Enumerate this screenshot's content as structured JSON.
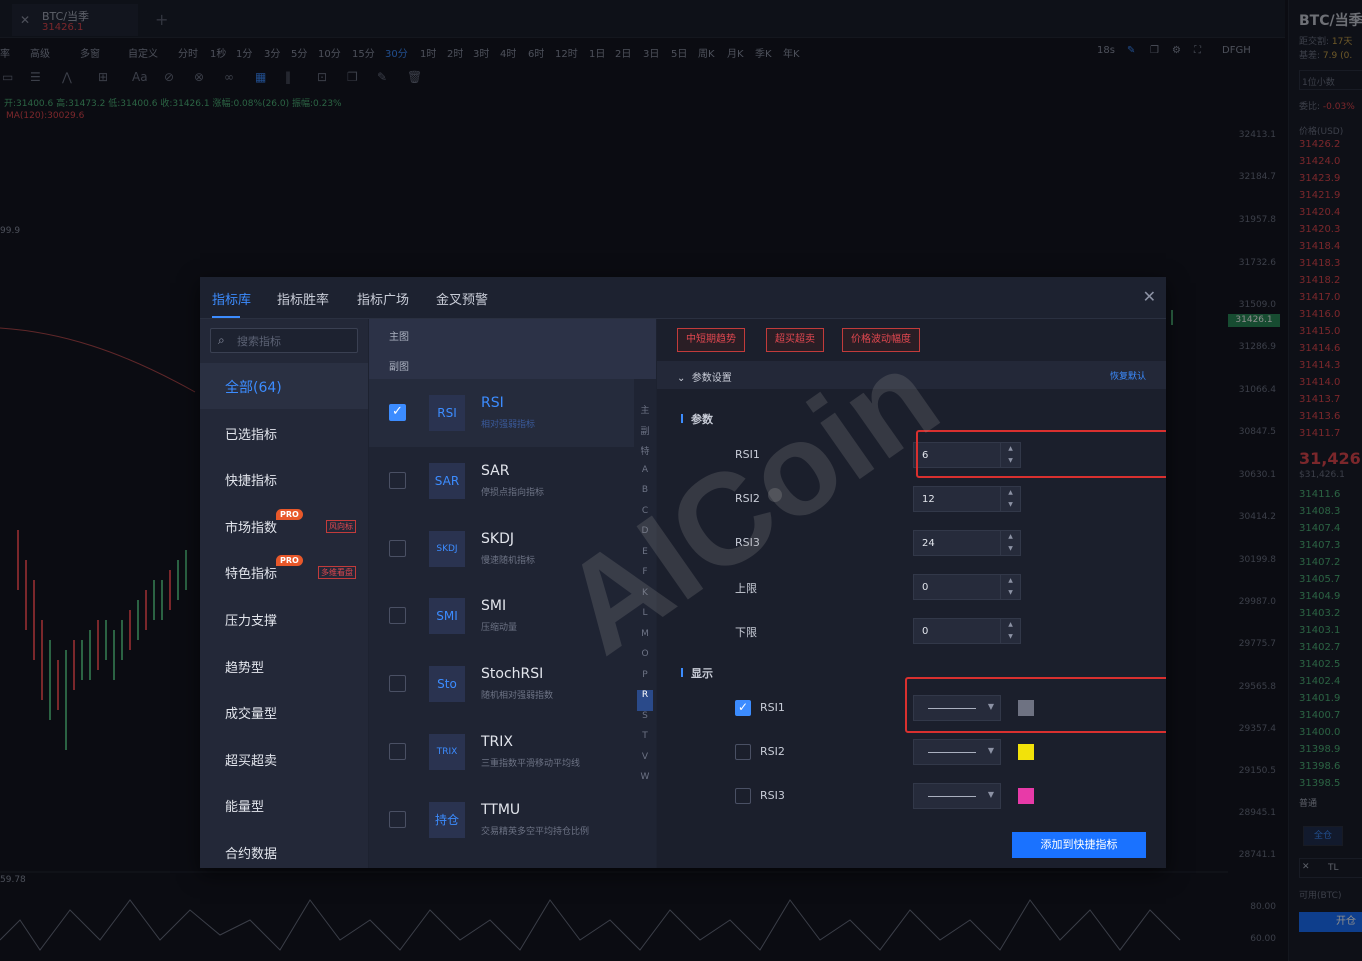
{
  "tab": {
    "title": "BTC/当季",
    "price": "31426.1",
    "close_icon": "close-icon",
    "add_icon": "plus-icon"
  },
  "periods": {
    "left_items": [
      "率",
      "高级",
      "多窗",
      "自定义",
      "分时",
      "1秒",
      "1分",
      "3分",
      "5分",
      "10分",
      "15分",
      "30分",
      "1时",
      "2时",
      "3时",
      "4时",
      "6时",
      "12时",
      "1日",
      "2日",
      "3日",
      "5日",
      "周K",
      "月K",
      "季K",
      "年K"
    ],
    "active": "30分",
    "right_time": "18s",
    "right_label": "DFGH"
  },
  "ohlc": "开:31400.6 高:31473.2 低:31400.6 收:31426.1 涨幅:0.08%(26.0) 振幅:0.23%",
  "ma": "MA(120):30029.6",
  "left_axis_labels": [
    "99.9",
    "59.78"
  ],
  "price_axis": {
    "ticks": [
      "32413.1",
      "32184.7",
      "31957.8",
      "31732.6",
      "31509.0",
      "31286.9",
      "31066.4",
      "30847.5",
      "30630.1",
      "30414.2",
      "30199.8",
      "29987.0",
      "29775.7",
      "29565.8",
      "29357.4",
      "29150.5",
      "28945.1",
      "28741.1",
      "80.00",
      "60.00"
    ],
    "current": "31426.1"
  },
  "right_panel": {
    "title": "BTC/当季",
    "delivery_label": "距交割:",
    "delivery_value": "17天",
    "basis_label": "基差:",
    "basis_value": "7.9 (0.",
    "precision": "1位小数",
    "ratio_label": "委比:",
    "ratio_value": "-0.03%",
    "price_header": "价格(USD)",
    "asks": [
      "31426.2",
      "31424.0",
      "31423.9",
      "31421.9",
      "31420.4",
      "31420.3",
      "31418.4",
      "31418.3",
      "31418.2",
      "31417.0",
      "31416.0",
      "31415.0",
      "31414.6",
      "31414.3",
      "31414.0",
      "31413.7",
      "31413.6",
      "31411.7"
    ],
    "last_price": "31,426.1",
    "last_sub": "$31,426.1",
    "bids": [
      "31411.6",
      "31408.3",
      "31407.4",
      "31407.3",
      "31407.2",
      "31405.7",
      "31404.9",
      "31403.2",
      "31403.1",
      "31402.7",
      "31402.5",
      "31402.4",
      "31401.9",
      "31400.7",
      "31400.0",
      "31398.9",
      "31398.6",
      "31398.5"
    ],
    "order_type": "普通",
    "all_btn": "全仓",
    "tl_label": "TL",
    "avail": "可用(BTC)",
    "open_btn": "开仓"
  },
  "modal": {
    "tabs": [
      "指标库",
      "指标胜率",
      "指标广场",
      "金叉预警"
    ],
    "active_tab": "指标库",
    "close_icon": "close-icon",
    "search_placeholder": "搜索指标",
    "categories": [
      {
        "label": "全部(64)",
        "active": true
      },
      {
        "label": "已选指标"
      },
      {
        "label": "快捷指标"
      },
      {
        "label": "市场指数",
        "pro": "PRO",
        "tag": "风向标"
      },
      {
        "label": "特色指标",
        "pro": "PRO",
        "tag": "多维看盘"
      },
      {
        "label": "压力支撑"
      },
      {
        "label": "趋势型"
      },
      {
        "label": "成交量型"
      },
      {
        "label": "超买超卖"
      },
      {
        "label": "能量型"
      },
      {
        "label": "合约数据"
      }
    ],
    "indicator_header": {
      "main": "主图",
      "sub": "副图"
    },
    "indicators": [
      {
        "badge": "RSI",
        "name": "RSI",
        "desc": "相对强弱指标",
        "checked": true
      },
      {
        "badge": "SAR",
        "name": "SAR",
        "desc": "停损点指向指标",
        "checked": false
      },
      {
        "badge": "SKDJ",
        "name": "SKDJ",
        "desc": "慢速随机指标",
        "checked": false
      },
      {
        "badge": "SMI",
        "name": "SMI",
        "desc": "压缩动量",
        "checked": false
      },
      {
        "badge": "Sto",
        "name": "StochRSI",
        "desc": "随机相对强弱指数",
        "checked": false
      },
      {
        "badge": "TRIX",
        "name": "TRIX",
        "desc": "三重指数平滑移动平均线",
        "checked": false
      },
      {
        "badge": "持仓",
        "name": "TTMU",
        "desc": "交易精英多空平均持仓比例",
        "checked": false
      }
    ],
    "alphabet": [
      "主",
      "副",
      "特",
      "A",
      "B",
      "C",
      "D",
      "E",
      "F",
      "K",
      "L",
      "M",
      "O",
      "P",
      "R",
      "S",
      "T",
      "V",
      "W"
    ],
    "alphabet_active": "R",
    "pills": [
      "中短期趋势",
      "超买超卖",
      "价格波动幅度"
    ],
    "settings_header": "参数设置",
    "reset_label": "恢复默认",
    "params_title": "参数",
    "params": [
      {
        "label": "RSI1",
        "value": "6"
      },
      {
        "label": "RSI2",
        "value": "12"
      },
      {
        "label": "RSI3",
        "value": "24"
      },
      {
        "label": "上限",
        "value": "0"
      },
      {
        "label": "下限",
        "value": "0"
      }
    ],
    "display_title": "显示",
    "display": [
      {
        "label": "RSI1",
        "checked": true,
        "color": "#6e7282"
      },
      {
        "label": "RSI2",
        "checked": false,
        "color": "#f2e20a"
      },
      {
        "label": "RSI3",
        "checked": false,
        "color": "#e83aa8"
      }
    ],
    "add_button": "添加到快捷指标",
    "watermark": "AICoin"
  }
}
